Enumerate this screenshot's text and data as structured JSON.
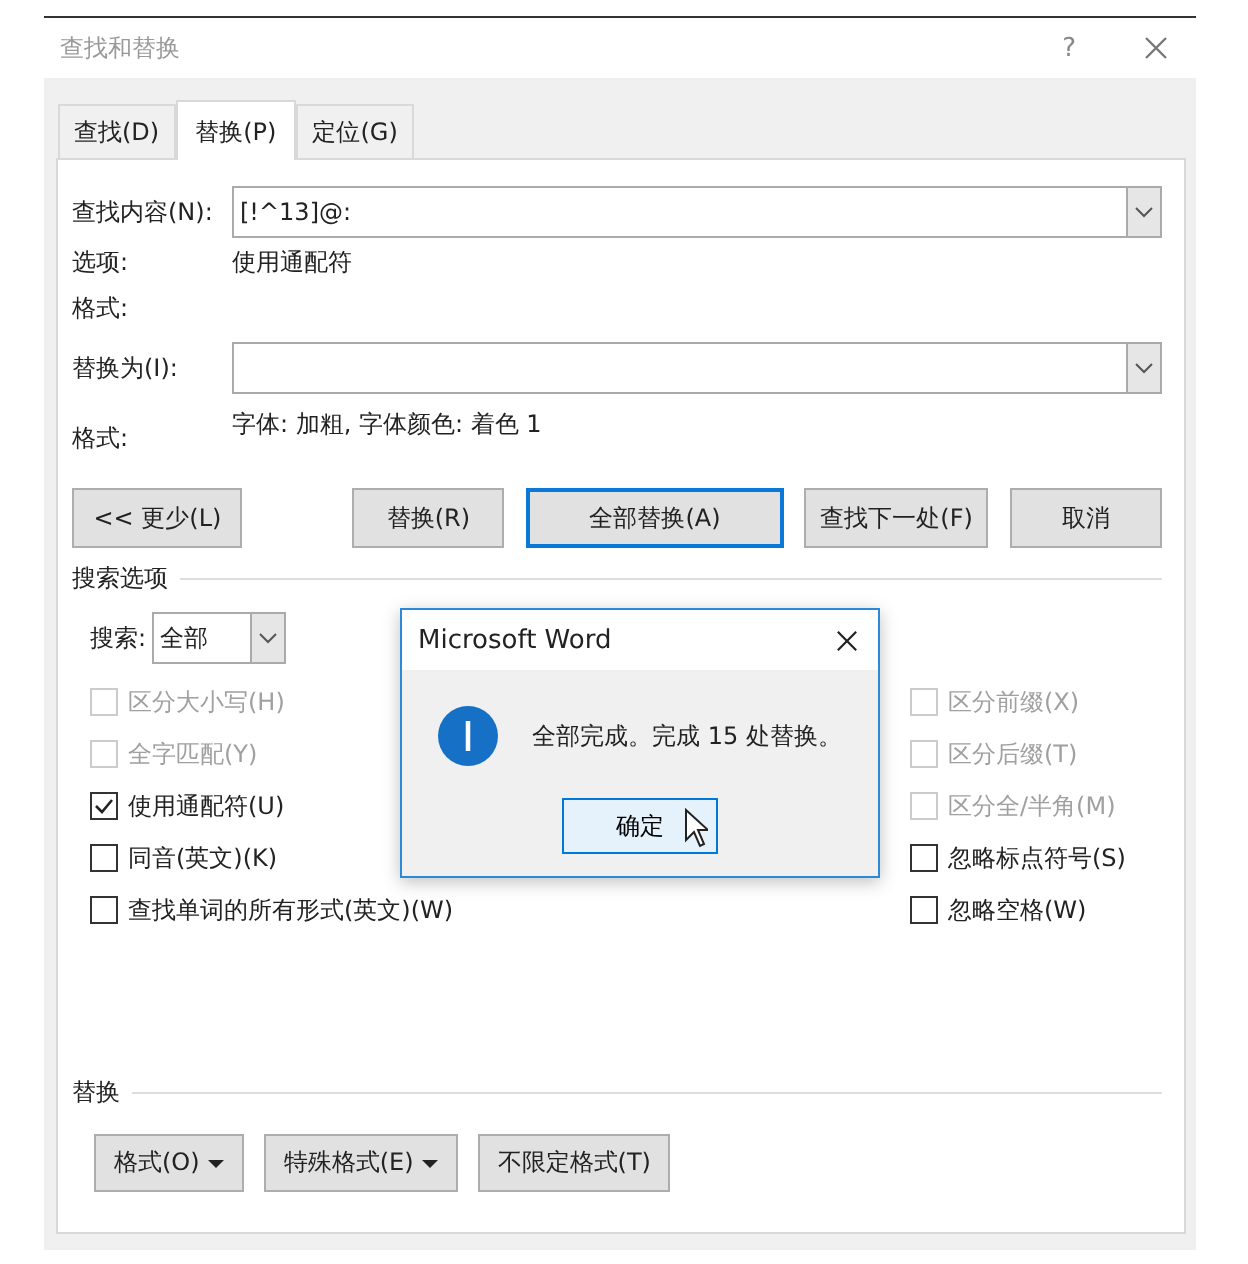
{
  "window": {
    "title": "查找和替换",
    "help": "?"
  },
  "tabs": [
    {
      "label": "查找(D)",
      "selected": false
    },
    {
      "label": "替换(P)",
      "selected": true
    },
    {
      "label": "定位(G)",
      "selected": false
    }
  ],
  "find": {
    "label": "查找内容(N):",
    "value": "[!^13]@:"
  },
  "find_options": {
    "label": "选项:",
    "value": "使用通配符"
  },
  "find_format": {
    "label": "格式:"
  },
  "replace": {
    "label": "替换为(I):"
  },
  "replace_format": {
    "label": "格式:",
    "value": "字体: 加粗, 字体颜色: 着色 1"
  },
  "buttons": [
    {
      "label": "<< 更少(L)",
      "focused": false
    },
    {
      "label": "替换(R)",
      "focused": false
    },
    {
      "label": "全部替换(A)",
      "focused": true
    },
    {
      "label": "查找下一处(F)",
      "focused": false
    },
    {
      "label": "取消",
      "focused": false
    }
  ],
  "search_options": {
    "title": "搜索选项",
    "search_label": "搜索:",
    "search_value": "全部"
  },
  "options_left": [
    {
      "label": "区分大小写(H)",
      "checked": false,
      "disabled": true
    },
    {
      "label": "全字匹配(Y)",
      "checked": false,
      "disabled": true
    },
    {
      "label": "使用通配符(U)",
      "checked": true,
      "disabled": false
    },
    {
      "label": "同音(英文)(K)",
      "checked": false,
      "disabled": false
    },
    {
      "label": "查找单词的所有形式(英文)(W)",
      "checked": false,
      "disabled": false
    }
  ],
  "options_right": [
    {
      "label": "区分前缀(X)",
      "checked": false,
      "disabled": true
    },
    {
      "label": "区分后缀(T)",
      "checked": false,
      "disabled": true
    },
    {
      "label": "区分全/半角(M)",
      "checked": false,
      "disabled": true
    },
    {
      "label": "忽略标点符号(S)",
      "checked": false,
      "disabled": false
    },
    {
      "label": "忽略空格(W)",
      "checked": false,
      "disabled": false
    }
  ],
  "replace_section": {
    "title": "替换",
    "buttons": [
      {
        "label": "格式(O)",
        "dropdown": true
      },
      {
        "label": "特殊格式(E)",
        "dropdown": true
      },
      {
        "label": "不限定格式(T)",
        "dropdown": false
      }
    ]
  },
  "message_box": {
    "title": "Microsoft Word",
    "message": "全部完成。完成 15 处替换。",
    "button": "确定"
  }
}
